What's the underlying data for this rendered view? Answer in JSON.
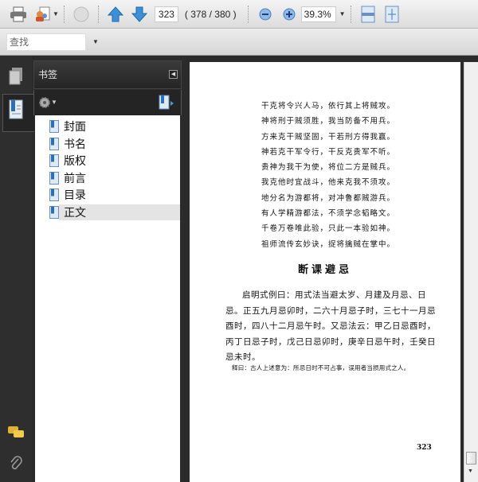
{
  "toolbar": {
    "page_number": "323",
    "page_count": "( 378 / 380 )",
    "zoom": "39.3%"
  },
  "findbar": {
    "placeholder": "查找"
  },
  "panel": {
    "title": "书签",
    "bookmarks": [
      {
        "label": "封面"
      },
      {
        "label": "书名"
      },
      {
        "label": "版权"
      },
      {
        "label": "前言"
      },
      {
        "label": "目录"
      },
      {
        "label": "正文",
        "selected": true
      }
    ]
  },
  "page": {
    "poem": [
      "干克将令兴人马，依行其上将贼攻。",
      "神将刑于贼须胜，我当防备不用兵。",
      "方来克干贼坚固，干若刑方得我赢。",
      "神若克干军令行，干反克贵军不听。",
      "贵神为我干为使，将位二方是贼兵。",
      "我克他时宜战斗，他来克我不须攻。",
      "地分名为游都将，对冲鲁都贼游兵。",
      "有人学精游都法，不须学念韬略文。",
      "千卷万卷唯此验，只此一本验如神。",
      "祖师流传玄妙诀，捉将擒贼在掌中。"
    ],
    "section_title": "断课避忌",
    "paragraph": "启明式例曰：用式法当避太岁、月建及月忌、日忌。正五九月忌卯时，二六十月忌子时，三七十一月忌酉时，四八十二月忌午时。又忌法云：甲乙日忌酉时，丙丁日忌子时，戊己日忌卯时，庚辛日忌午时，壬癸日忌未时。",
    "note": "释曰：古人上述意为：所忌日时不可占事，误用者当损用式之人。",
    "page_number": "323"
  }
}
